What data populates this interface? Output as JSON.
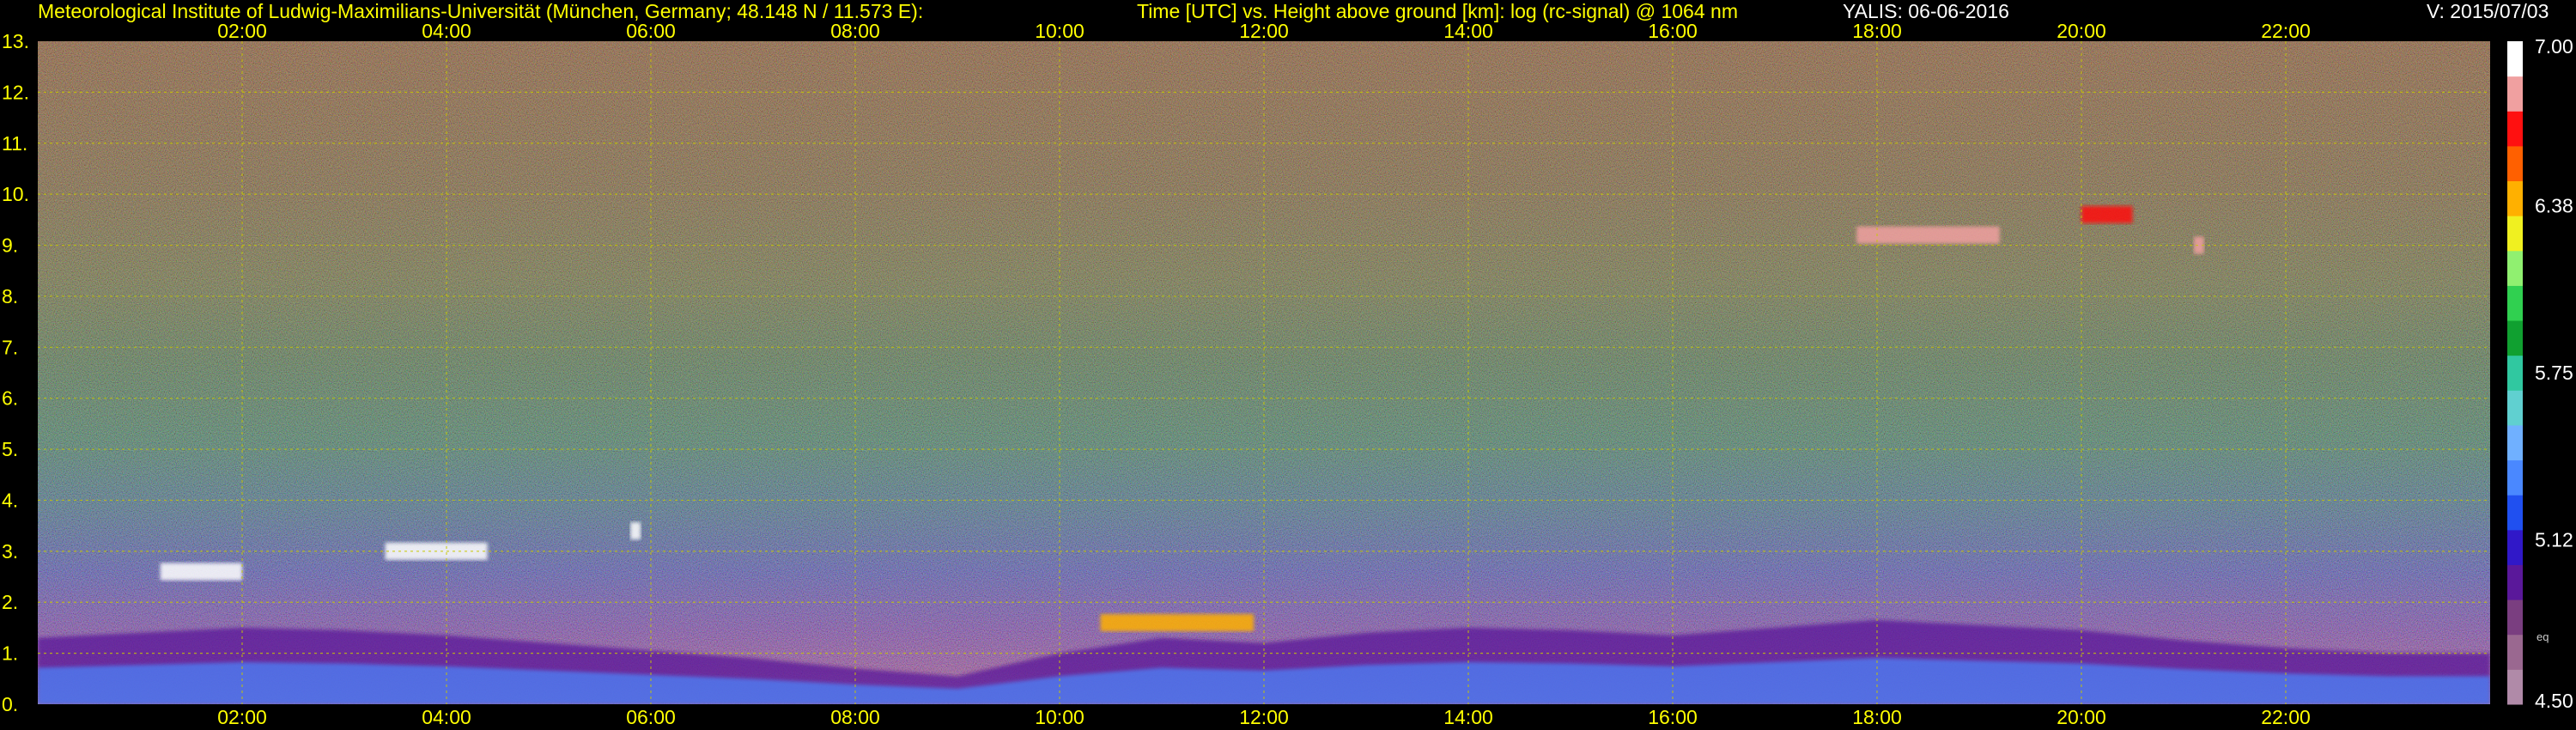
{
  "header": {
    "institute": "Meteorological Institute of Ludwig-Maximilians-Universität (München, Germany; 48.148 N / 11.573 E):",
    "plot_title": "Time [UTC] vs. Height above ground [km]: log (rc-signal) @ 1064 nm",
    "instrument": "YALIS: 06-06-2016",
    "version": "V: 2015/07/03"
  },
  "colorbar": {
    "ticks": [
      "7.00",
      "6.38",
      "5.75",
      "5.12",
      "4.50"
    ],
    "tick_values": [
      7.0,
      6.38,
      5.75,
      5.12,
      4.5
    ],
    "unit_label": "eq",
    "range": [
      4.5,
      7.0
    ],
    "colors": [
      "#b08aa8",
      "#9a6890",
      "#7a3e80",
      "#5a189a",
      "#3018c8",
      "#2050f0",
      "#4a88ff",
      "#70b0ff",
      "#60d0d0",
      "#30c8a0",
      "#10a030",
      "#30d050",
      "#90f070",
      "#f0f020",
      "#ffb000",
      "#ff6000",
      "#ff1010",
      "#f0a0a0",
      "#ffffff"
    ]
  },
  "chart_data": {
    "type": "heatmap",
    "title": "Time [UTC] vs. Height above ground [km]: log (rc-signal) @ 1064 nm",
    "xlabel": "",
    "ylabel": "",
    "x_ticks": [
      "02:00",
      "04:00",
      "06:00",
      "08:00",
      "10:00",
      "12:00",
      "14:00",
      "16:00",
      "18:00",
      "20:00",
      "22:00"
    ],
    "x_tick_hours": [
      2,
      4,
      6,
      8,
      10,
      12,
      14,
      16,
      18,
      20,
      22
    ],
    "xlim_hours": [
      0,
      24
    ],
    "y_ticks": [
      "0.",
      "1.",
      "2.",
      "3.",
      "4.",
      "5.",
      "6.",
      "7.",
      "8.",
      "9.",
      "10.",
      "11.",
      "12.",
      "13."
    ],
    "y_tick_values": [
      0,
      1,
      2,
      3,
      4,
      5,
      6,
      7,
      8,
      9,
      10,
      11,
      12,
      13
    ],
    "ylim_km": [
      0,
      13
    ],
    "value_range": [
      4.5,
      7.0
    ],
    "grid": true,
    "boundary_layer_top_km": [
      [
        0.0,
        1.3
      ],
      [
        1.0,
        1.4
      ],
      [
        2.0,
        1.5
      ],
      [
        3.0,
        1.45
      ],
      [
        4.0,
        1.35
      ],
      [
        5.0,
        1.2
      ],
      [
        6.0,
        1.05
      ],
      [
        7.0,
        0.9
      ],
      [
        8.0,
        0.7
      ],
      [
        9.0,
        0.55
      ],
      [
        10.0,
        1.0
      ],
      [
        11.0,
        1.3
      ],
      [
        12.0,
        1.2
      ],
      [
        13.0,
        1.4
      ],
      [
        14.0,
        1.5
      ],
      [
        15.0,
        1.45
      ],
      [
        16.0,
        1.35
      ],
      [
        17.0,
        1.5
      ],
      [
        18.0,
        1.65
      ],
      [
        19.0,
        1.55
      ],
      [
        20.0,
        1.45
      ],
      [
        21.0,
        1.25
      ],
      [
        22.0,
        1.1
      ],
      [
        23.0,
        1.0
      ],
      [
        24.0,
        1.0
      ]
    ],
    "cloud_features": [
      {
        "t_start": 1.2,
        "t_end": 2.0,
        "h_km": 2.6,
        "value": 6.9
      },
      {
        "t_start": 3.4,
        "t_end": 4.4,
        "h_km": 3.0,
        "value": 7.0
      },
      {
        "t_start": 5.8,
        "t_end": 5.9,
        "h_km": 3.4,
        "value": 6.9
      },
      {
        "t_start": 10.4,
        "t_end": 11.9,
        "h_km": 1.6,
        "value": 6.4
      },
      {
        "t_start": 17.8,
        "t_end": 19.2,
        "h_km": 9.2,
        "value": 6.8
      },
      {
        "t_start": 20.0,
        "t_end": 20.5,
        "h_km": 9.6,
        "value": 6.7
      },
      {
        "t_start": 21.1,
        "t_end": 21.2,
        "h_km": 9.0,
        "value": 6.8
      }
    ]
  }
}
